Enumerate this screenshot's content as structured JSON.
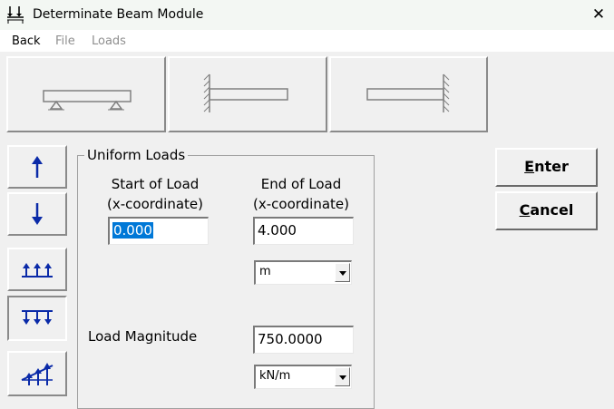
{
  "window": {
    "title": "Determinate Beam Module",
    "close_symbol": "✕"
  },
  "menu": {
    "items": [
      {
        "label": "Back",
        "enabled": true
      },
      {
        "label": "File",
        "enabled": false
      },
      {
        "label": "Loads",
        "enabled": false
      }
    ]
  },
  "beam_types": [
    {
      "icon": "simply-supported-beam-icon"
    },
    {
      "icon": "cantilever-left-fixed-icon"
    },
    {
      "icon": "cantilever-right-fixed-icon"
    }
  ],
  "load_types": [
    {
      "icon": "point-load-up-icon",
      "pressed": false
    },
    {
      "icon": "point-load-down-icon",
      "pressed": false
    },
    {
      "icon": "uniform-load-up-icon",
      "pressed": false
    },
    {
      "icon": "uniform-load-down-icon",
      "pressed": true
    },
    {
      "icon": "linear-load-up-icon",
      "pressed": false
    }
  ],
  "uniform_loads": {
    "title": "Uniform Loads",
    "start_label_1": "Start of Load",
    "start_label_2": "(x-coordinate)",
    "start_value": "0.000",
    "end_label_1": "End of Load",
    "end_label_2": "(x-coordinate)",
    "end_value": "4.000",
    "length_unit": "m",
    "magnitude_label": "Load Magnitude",
    "magnitude_value": "750.0000",
    "force_unit": "kN/m"
  },
  "buttons": {
    "enter_accel": "E",
    "enter_rest": "nter",
    "cancel_accel": "C",
    "cancel_rest": "ancel"
  },
  "colors": {
    "selection": "#0078d7",
    "icon_blue": "#0a2aa8"
  }
}
